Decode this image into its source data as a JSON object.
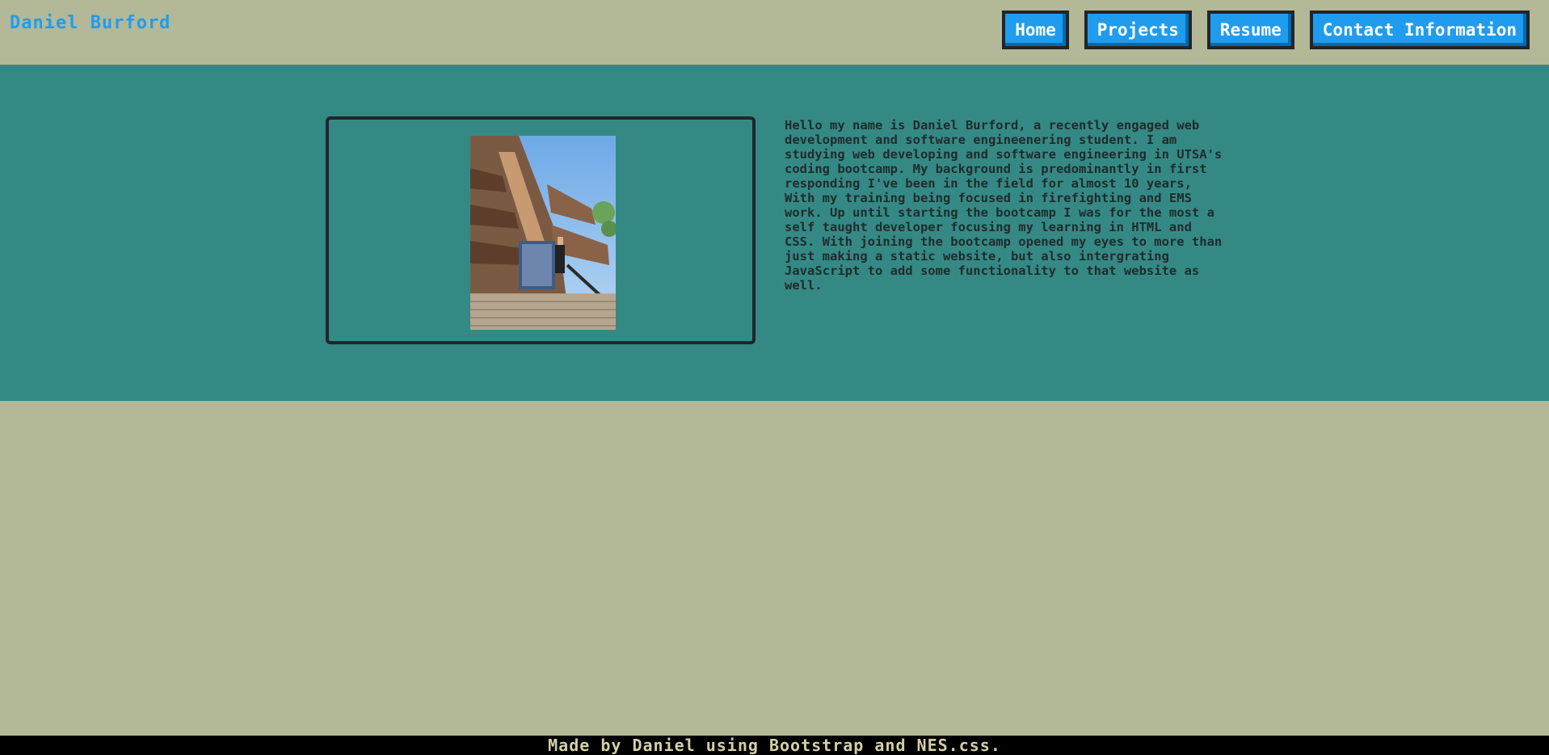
{
  "header": {
    "brand": "Daniel Burford",
    "nav": [
      "Home",
      "Projects",
      "Resume",
      "Contact Information"
    ]
  },
  "about": {
    "photo_icon": "profile-photo",
    "bio": "Hello my name is Daniel Burford, a recently engaged web development and software engineenering student. I am studying web developing and software engineering in UTSA's coding bootcamp. My background is predominantly in first responding I've been in the field for almost 10 years, With my training being focused in firefighting and EMS work. Up until starting the bootcamp I was for the most a self taught developer focusing my learning in HTML and CSS. With joining the bootcamp opened my eyes to more than just making a static website, but also intergrating JavaScript to add some functionality to that website as well."
  },
  "footer": {
    "text": "Made by Daniel using Bootstrap and NES.css."
  },
  "colors": {
    "page_bg": "#b3b896",
    "band_bg": "#358985",
    "accent": "#209cee",
    "footer_bg": "#000000"
  }
}
